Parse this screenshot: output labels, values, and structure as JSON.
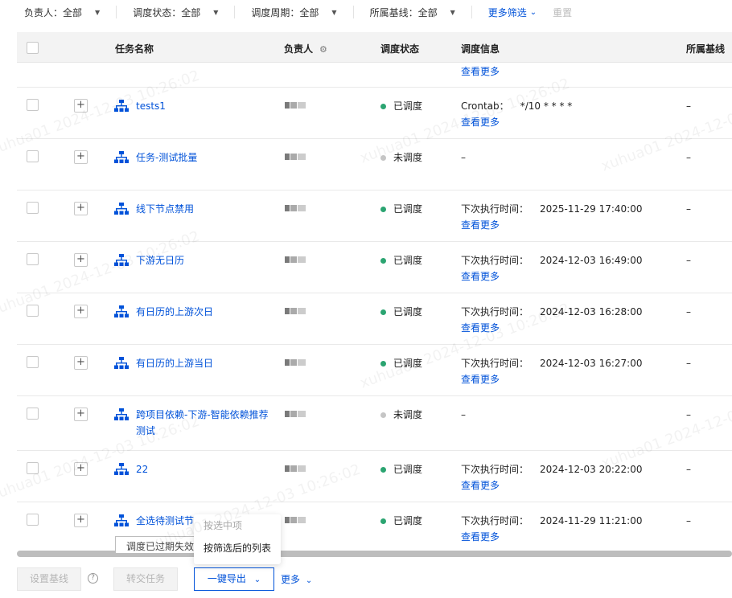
{
  "filters": [
    {
      "label": "负责人：",
      "value": "全部"
    },
    {
      "label": "调度状态：",
      "value": "全部"
    },
    {
      "label": "调度周期：",
      "value": "全部"
    },
    {
      "label": "所属基线：",
      "value": "全部"
    }
  ],
  "more_filter": "更多筛选",
  "reset": "重置",
  "columns": {
    "name": "任务名称",
    "owner": "负责人",
    "status": "调度状态",
    "sched": "调度信息",
    "baseline": "所属基线"
  },
  "top_partial": {
    "more": "查看更多"
  },
  "rows": [
    {
      "name": "tests1",
      "status": "已调度",
      "status_color": "#2ba471",
      "sched_label": "Crontab：",
      "sched_value": "*/10 * * * *",
      "more": "查看更多",
      "baseline": "–"
    },
    {
      "name": "任务-测试批量",
      "status": "未调度",
      "status_color": "#c5c5c5",
      "sched_label": "–",
      "sched_value": "",
      "more": "",
      "baseline": "–"
    },
    {
      "name": "线下节点禁用",
      "status": "已调度",
      "status_color": "#2ba471",
      "sched_label": "下次执行时间：",
      "sched_value": "2025-11-29 17:40:00",
      "more": "查看更多",
      "baseline": "–"
    },
    {
      "name": "下游无日历",
      "status": "已调度",
      "status_color": "#2ba471",
      "sched_label": "下次执行时间：",
      "sched_value": "2024-12-03 16:49:00",
      "more": "查看更多",
      "baseline": "–"
    },
    {
      "name": "有日历的上游次日",
      "status": "已调度",
      "status_color": "#2ba471",
      "sched_label": "下次执行时间：",
      "sched_value": "2024-12-03 16:28:00",
      "more": "查看更多",
      "baseline": "–"
    },
    {
      "name": "有日历的上游当日",
      "status": "已调度",
      "status_color": "#2ba471",
      "sched_label": "下次执行时间：",
      "sched_value": "2024-12-03 16:27:00",
      "more": "查看更多",
      "baseline": "–"
    },
    {
      "name": "跨项目依赖-下游-智能依赖推荐测试",
      "status": "未调度",
      "status_color": "#c5c5c5",
      "sched_label": "–",
      "sched_value": "",
      "more": "",
      "baseline": "–"
    },
    {
      "name": "22",
      "status": "已调度",
      "status_color": "#2ba471",
      "sched_label": "下次执行时间：",
      "sched_value": "2024-12-03 20:22:00",
      "more": "查看更多",
      "baseline": "–"
    },
    {
      "name": "全选待测试节",
      "status": "已调度",
      "status_color": "#2ba471",
      "sched_label": "下次执行时间：",
      "sched_value": "2024-11-29 11:21:00",
      "more": "查看更多",
      "baseline": "–"
    }
  ],
  "expired_tag": "调度已过期失效",
  "dropdown": {
    "opt1": "按选中项",
    "opt2": "按筛选后的列表"
  },
  "footer": {
    "set_baseline": "设置基线",
    "help": "?",
    "transfer": "转交任务",
    "export": "一键导出",
    "more": "更多"
  },
  "watermark": "xuhua01 2024-12-03 10:26:02",
  "colors": {
    "brand": "#0052d9",
    "scheduled": "#2ba471",
    "unscheduled": "#c5c5c5"
  }
}
